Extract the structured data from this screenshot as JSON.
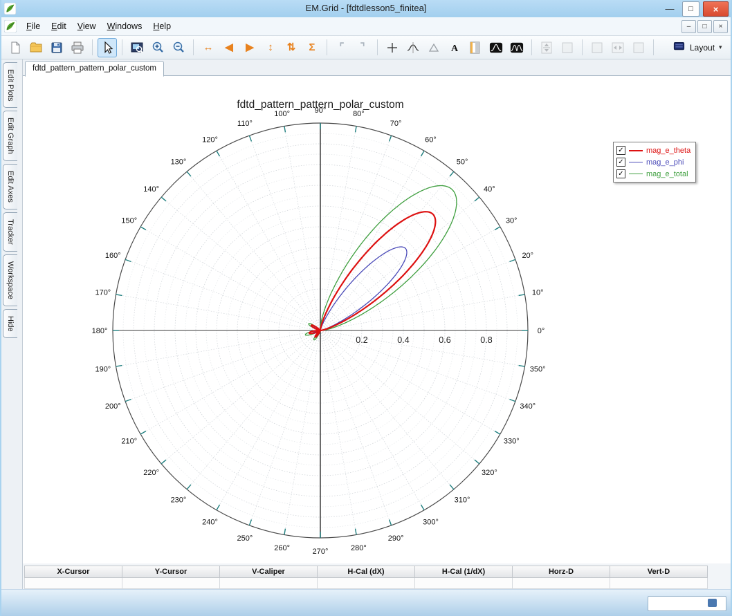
{
  "window": {
    "title": "EM.Grid - [fdtdlesson5_finitea]",
    "controls": [
      {
        "name": "minimize-button",
        "glyph": "—",
        "style": "flat"
      },
      {
        "name": "maximize-button",
        "glyph": "□",
        "style": "white"
      },
      {
        "name": "close-button",
        "glyph": "×",
        "style": "red"
      }
    ]
  },
  "menu": {
    "items": [
      "File",
      "Edit",
      "View",
      "Windows",
      "Help"
    ],
    "mdi_controls": [
      {
        "name": "mdi-minimize-button",
        "glyph": "–"
      },
      {
        "name": "mdi-restore-button",
        "glyph": "□"
      },
      {
        "name": "mdi-close-button",
        "glyph": "×"
      }
    ]
  },
  "toolbar": {
    "layout_label": "Layout",
    "layout_caret": "▾",
    "items": [
      {
        "name": "new-file-icon",
        "kind": "page"
      },
      {
        "name": "open-file-icon",
        "kind": "folder"
      },
      {
        "name": "save-icon",
        "kind": "floppy"
      },
      {
        "name": "print-icon",
        "kind": "printer"
      },
      {
        "sep": true
      },
      {
        "name": "pointer-tool-icon",
        "kind": "cursor",
        "selected": true
      },
      {
        "sep": true
      },
      {
        "name": "zoom-window-icon",
        "kind": "zoomwin"
      },
      {
        "name": "zoom-in-icon",
        "kind": "zoomin"
      },
      {
        "name": "zoom-out-icon",
        "kind": "zoomout"
      },
      {
        "sep": true
      },
      {
        "name": "fit-width-icon",
        "kind": "glyph",
        "glyph": "↔",
        "color": "#e8821e"
      },
      {
        "name": "pan-left-icon",
        "kind": "glyph",
        "glyph": "◀",
        "color": "#e8821e"
      },
      {
        "name": "pan-right-icon",
        "kind": "glyph",
        "glyph": "▶",
        "color": "#e8821e"
      },
      {
        "name": "fit-height-icon",
        "kind": "glyph",
        "glyph": "↕",
        "color": "#e8821e"
      },
      {
        "name": "pan-vertical-icon",
        "kind": "glyph",
        "glyph": "⇅",
        "color": "#e8821e"
      },
      {
        "name": "autoscale-icon",
        "kind": "glyph",
        "glyph": "Σ",
        "color": "#e8821e"
      },
      {
        "sep": true
      },
      {
        "name": "select-region-icon",
        "kind": "glyph",
        "glyph": "⌜",
        "color": "#aab4be"
      },
      {
        "name": "select-region2-icon",
        "kind": "glyph",
        "glyph": "⌝",
        "color": "#aab4be"
      },
      {
        "sep": true
      },
      {
        "name": "crosshair-icon",
        "kind": "crosshair"
      },
      {
        "name": "curve-tracker-icon",
        "kind": "curvetrack"
      },
      {
        "name": "caliper-icon",
        "kind": "triangle"
      },
      {
        "name": "text-label-icon",
        "kind": "textA"
      },
      {
        "name": "split-view-icon",
        "kind": "halfpage"
      },
      {
        "name": "curve-style-icon",
        "kind": "blackcurve"
      },
      {
        "name": "curve-style2-icon",
        "kind": "blackcurve2"
      },
      {
        "sep": true
      },
      {
        "name": "expand-vertical-icon",
        "kind": "boxvarrow",
        "disabled": true
      },
      {
        "name": "expand-vertical2-icon",
        "kind": "boxplain",
        "disabled": true
      },
      {
        "sep": true
      },
      {
        "name": "expand-horizontal-icon",
        "kind": "boxplain",
        "disabled": true
      },
      {
        "name": "expand-horizontal2-icon",
        "kind": "boxharrow",
        "disabled": true
      },
      {
        "name": "expand-horizontal3-icon",
        "kind": "boxplain",
        "disabled": true
      },
      {
        "sep": true
      },
      {
        "name": "layout-dropdown",
        "kind": "layout"
      }
    ]
  },
  "sidebar": {
    "tabs": [
      "Edit Plots",
      "Edit Graph",
      "Edit Axes",
      "Tracker",
      "Workspace",
      "Hide"
    ]
  },
  "doc_tab": "fdtd_pattern_pattern_polar_custom",
  "legend": {
    "items": [
      {
        "label": "mag_e_theta",
        "checked": true
      },
      {
        "label": "mag_e_phi",
        "checked": true
      },
      {
        "label": "mag_e_total",
        "checked": true
      }
    ],
    "check_glyph": "✓"
  },
  "tracker_table": {
    "headers": [
      "X-Cursor",
      "Y-Cursor",
      "V-Caliper",
      "H-Cal (dX)",
      "H-Cal (1/dX)",
      "Horz-D",
      "Vert-D"
    ],
    "values": [
      "",
      "",
      "",
      "",
      "",
      "",
      ""
    ]
  },
  "chart_data": {
    "type": "polar",
    "title": "fdtd_pattern_pattern_polar_custom",
    "rmax": 1.0,
    "radial_ticks": [
      0.2,
      0.4,
      0.6,
      0.8
    ],
    "angle_tick_step_deg": 10,
    "grid": true,
    "legend_position": "top-right",
    "series": [
      {
        "name": "mag_e_theta",
        "color": "#dd1111",
        "line_width": 2.2,
        "main_lobe": {
          "peak_r": 0.78,
          "peak_deg": 46,
          "sigma_deg": 12.5
        },
        "minor_lobes": [
          {
            "center_deg": 150,
            "half_width_deg": 14,
            "peak_r": 0.05
          },
          {
            "center_deg": 193,
            "half_width_deg": 14,
            "peak_r": 0.055
          },
          {
            "center_deg": 232,
            "half_width_deg": 14,
            "peak_r": 0.04
          }
        ]
      },
      {
        "name": "mag_e_phi",
        "color": "#4a4ab8",
        "line_width": 1.3,
        "main_lobe": {
          "peak_r": 0.57,
          "peak_deg": 44,
          "sigma_deg": 11
        },
        "minor_lobes": [
          {
            "center_deg": 150,
            "half_width_deg": 14,
            "peak_r": 0.035
          },
          {
            "center_deg": 200,
            "half_width_deg": 14,
            "peak_r": 0.04
          }
        ]
      },
      {
        "name": "mag_e_total",
        "color": "#3f9f3f",
        "line_width": 1.3,
        "main_lobe": {
          "peak_r": 0.93,
          "peak_deg": 47,
          "sigma_deg": 15
        },
        "minor_lobes": [
          {
            "center_deg": 150,
            "half_width_deg": 14,
            "peak_r": 0.065
          },
          {
            "center_deg": 196,
            "half_width_deg": 14,
            "peak_r": 0.075
          },
          {
            "center_deg": 236,
            "half_width_deg": 14,
            "peak_r": 0.055
          }
        ]
      }
    ]
  }
}
